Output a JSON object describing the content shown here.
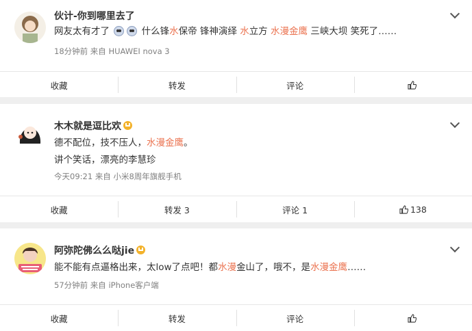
{
  "comments": [
    {
      "username": "伙计-你到哪里去了",
      "content_parts": [
        "网友太有才了",
        "什么锋",
        "水",
        "保帝 锋神演绎 ",
        "水",
        "立方 ",
        "水漫金鹰",
        " 三峡大坝 笑死了……"
      ],
      "time": "18分钟前",
      "source_prefix": "来自",
      "source": "HUAWEI nova 3",
      "actions": {
        "collect": "收藏",
        "repost": "转发",
        "comment": "评论",
        "like": ""
      }
    },
    {
      "username": "木木就是逗比欢",
      "content_parts": [
        "德不配位，技不压人，",
        "水漫金鹰",
        "。"
      ],
      "line2": "讲个笑话，漂亮的李慧珍",
      "time": "今天09:21",
      "source_prefix": "来自",
      "source": "小米8周年旗舰手机",
      "actions": {
        "collect": "收藏",
        "repost": "转发 3",
        "comment": "评论 1",
        "like": "138"
      }
    },
    {
      "username": "阿弥陀佛么么哒jie",
      "content_parts": [
        "能不能有点逼格出来，太low了点吧！都",
        "水漫",
        "金山了，哦不，是",
        "水漫金鹰",
        "……"
      ],
      "time": "57分钟前",
      "source_prefix": "来自",
      "source": "iPhone客户端",
      "actions": {
        "collect": "收藏",
        "repost": "转发",
        "comment": "评论",
        "like": ""
      }
    }
  ],
  "colors": {
    "highlight": "#eb7350",
    "meta": "#808080",
    "background": "#efefef"
  }
}
